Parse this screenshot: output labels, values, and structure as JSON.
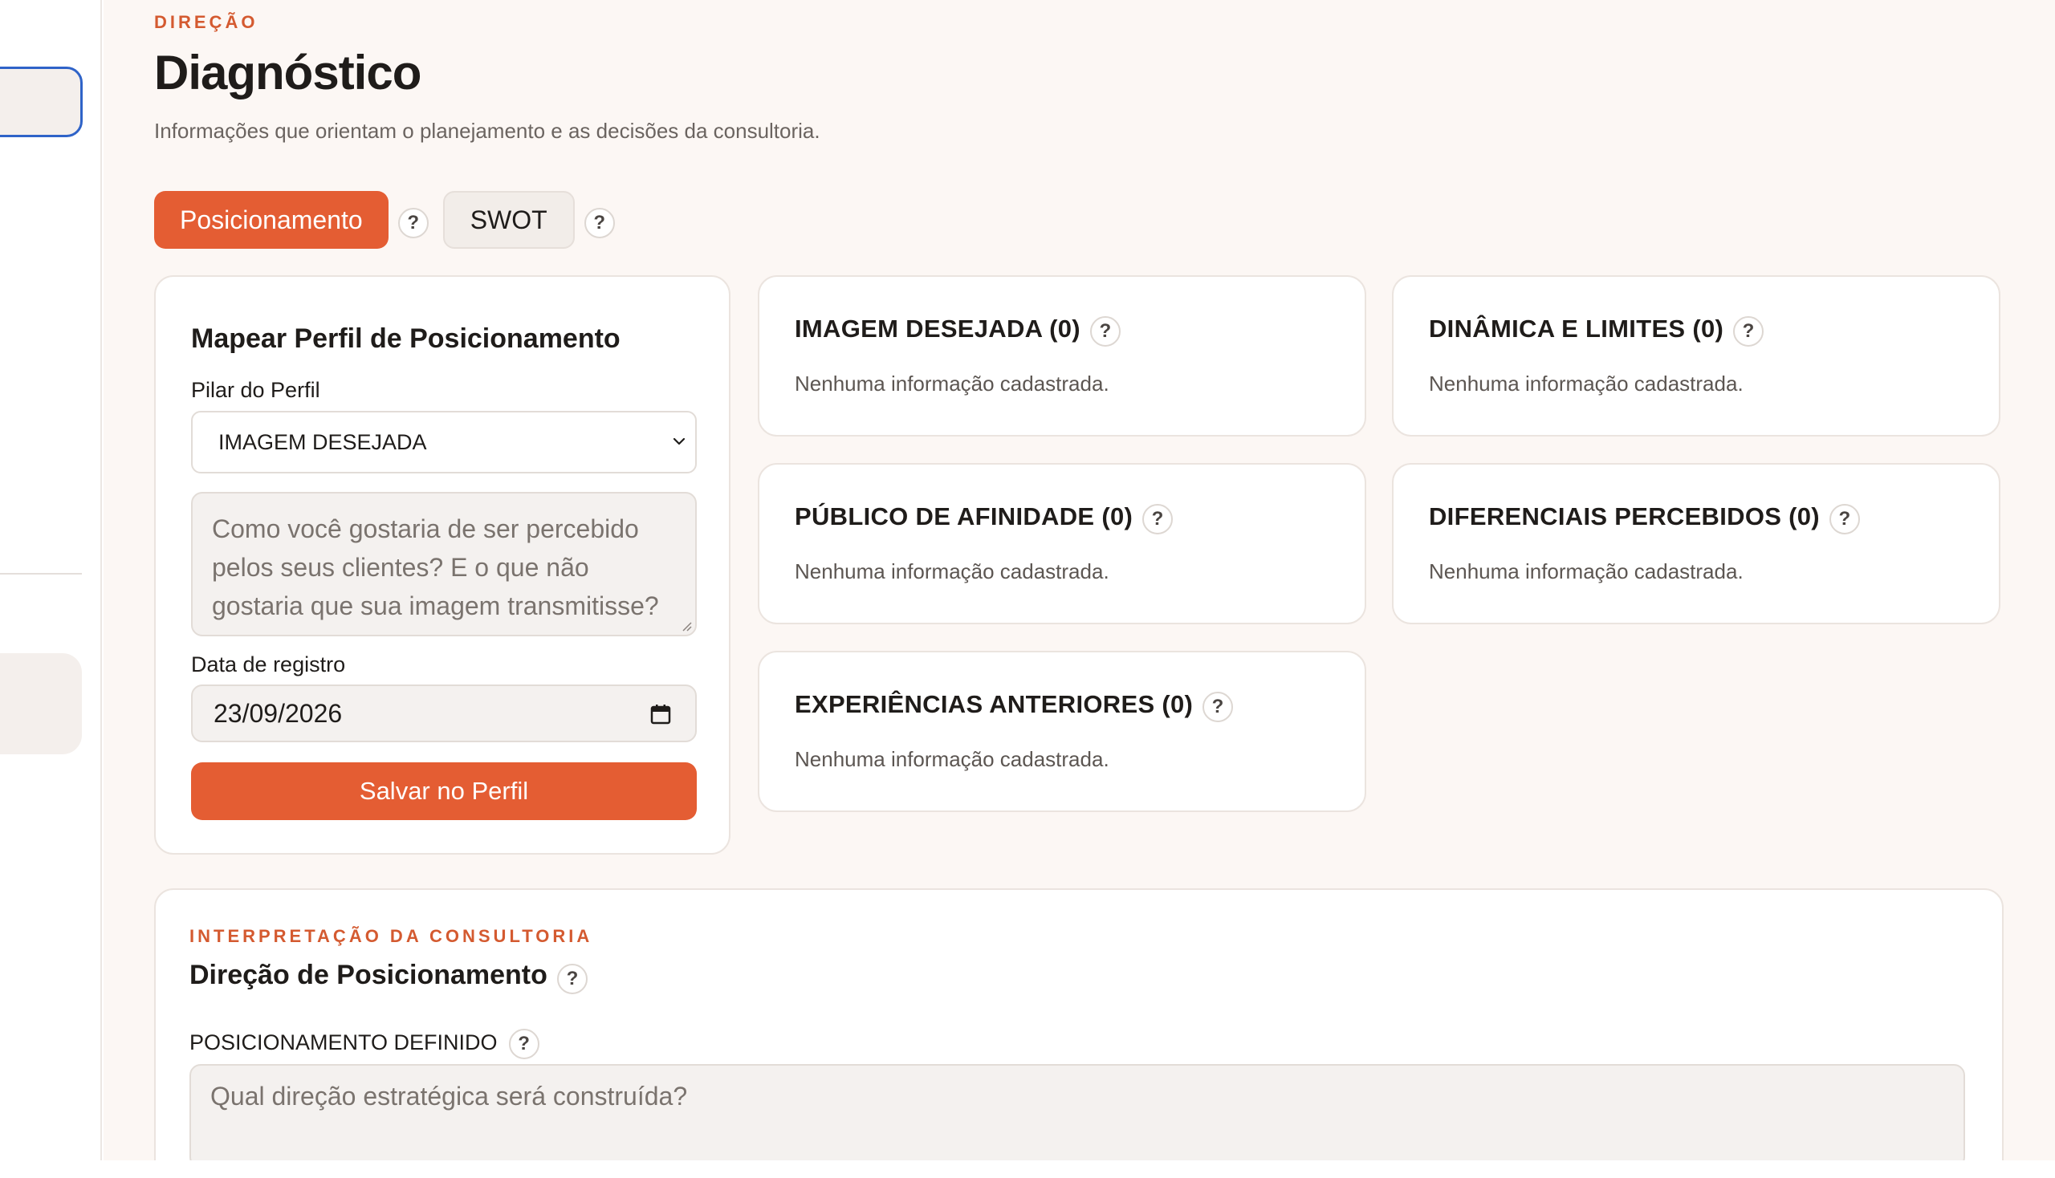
{
  "header": {
    "eyebrow": "DIREÇÃO",
    "title": "Diagnóstico",
    "subtitle": "Informações que orientam o planejamento e as decisões da consultoria."
  },
  "tabs": [
    {
      "label": "Posicionamento",
      "active": true
    },
    {
      "label": "SWOT",
      "active": false
    }
  ],
  "help_glyph": "?",
  "form": {
    "title": "Mapear Perfil de Posicionamento",
    "pillar_label": "Pilar do Perfil",
    "pillar_value": "IMAGEM DESEJADA",
    "textarea_placeholder": "Como você gostaria de ser percebido pelos seus clientes? E o que não gostaria que sua imagem transmitisse?",
    "date_label": "Data de registro",
    "date_value": "23/09/2026",
    "submit_label": "Salvar no Perfil"
  },
  "pillars": [
    {
      "title": "IMAGEM DESEJADA (0)",
      "empty": "Nenhuma informação cadastrada."
    },
    {
      "title": "DINÂMICA E LIMITES (0)",
      "empty": "Nenhuma informação cadastrada."
    },
    {
      "title": "PÚBLICO DE AFINIDADE (0)",
      "empty": "Nenhuma informação cadastrada."
    },
    {
      "title": "DIFERENCIAIS PERCEBIDOS (0)",
      "empty": "Nenhuma informação cadastrada."
    },
    {
      "title": "EXPERIÊNCIAS ANTERIORES (0)",
      "empty": "Nenhuma informação cadastrada."
    }
  ],
  "interpretation": {
    "eyebrow": "INTERPRETAÇÃO DA CONSULTORIA",
    "title": "Direção de Posicionamento",
    "field_label": "POSICIONAMENTO DEFINIDO",
    "placeholder": "Qual direção estratégica será construída?"
  },
  "colors": {
    "accent": "#e45d33",
    "accent_text": "#d45a30",
    "background": "#fcf7f4",
    "focus_ring": "#2f63c8"
  },
  "icons": [
    "help-circle-icon",
    "chevron-down-icon",
    "calendar-icon",
    "resize-handle-icon"
  ]
}
